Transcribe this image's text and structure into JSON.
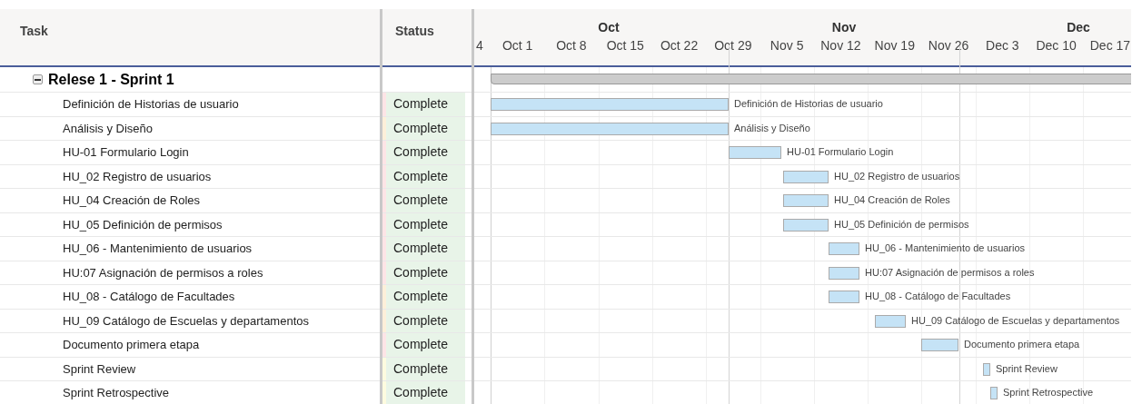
{
  "columns": {
    "task": "Task",
    "status": "Status"
  },
  "timeline": {
    "months": [
      "Oct",
      "Nov",
      "Dec"
    ],
    "weeks": [
      "4",
      "Oct 1",
      "Oct 8",
      "Oct 15",
      "Oct 22",
      "Oct 29",
      "Nov 5",
      "Nov 12",
      "Nov 19",
      "Nov 26",
      "Dec 3",
      "Dec 10",
      "Dec 17"
    ]
  },
  "group": {
    "name": "Relese 1 - Sprint 1",
    "expanded": true
  },
  "tasks": [
    {
      "name": "Definición de Historias de usuario",
      "status": "Complete",
      "color": "#fde4e6",
      "bar_label": "Definición de Historias de usuario"
    },
    {
      "name": "Análisis y Diseño",
      "status": "Complete",
      "color": "#fdefd9",
      "bar_label": "Análisis y Diseño"
    },
    {
      "name": "HU-01 Formulario Login",
      "status": "Complete",
      "color": "#fde4e6",
      "bar_label": "HU-01 Formulario Login"
    },
    {
      "name": "HU_02 Registro de usuarios",
      "status": "Complete",
      "color": "#fde4e6",
      "bar_label": "HU_02 Registro de usuarios"
    },
    {
      "name": "HU_04 Creación de Roles",
      "status": "Complete",
      "color": "#fde4e6",
      "bar_label": "HU_04 Creación de Roles"
    },
    {
      "name": "HU_05 Definición de permisos",
      "status": "Complete",
      "color": "#fde4e6",
      "bar_label": "HU_05 Definición de permisos"
    },
    {
      "name": "HU_06 - Mantenimiento de usuarios",
      "status": "Complete",
      "color": "#fde4e6",
      "bar_label": "HU_06 - Mantenimiento de usuarios"
    },
    {
      "name": "HU:07 Asignación de permisos a roles",
      "status": "Complete",
      "color": "#fde4e6",
      "bar_label": "HU:07 Asignación de permisos a roles"
    },
    {
      "name": "HU_08 - Catálogo de Facultades",
      "status": "Complete",
      "color": "#fdefd9",
      "bar_label": "HU_08 - Catálogo de Facultades"
    },
    {
      "name": "HU_09 Catálogo de Escuelas y departamentos",
      "status": "Complete",
      "color": "#fdefd9",
      "bar_label": "HU_09 Catálogo de Escuelas y departamentos"
    },
    {
      "name": "Documento primera etapa",
      "status": "Complete",
      "color": "#fde4e6",
      "bar_label": "Documento primera etapa"
    },
    {
      "name": "Sprint Review",
      "status": "Complete",
      "color": "#fdfbdf",
      "bar_label": "Sprint Review"
    },
    {
      "name": "Sprint Retrospective",
      "status": "Complete",
      "color": "#fdfbdf",
      "bar_label": "Sprint Retrospective"
    }
  ]
}
